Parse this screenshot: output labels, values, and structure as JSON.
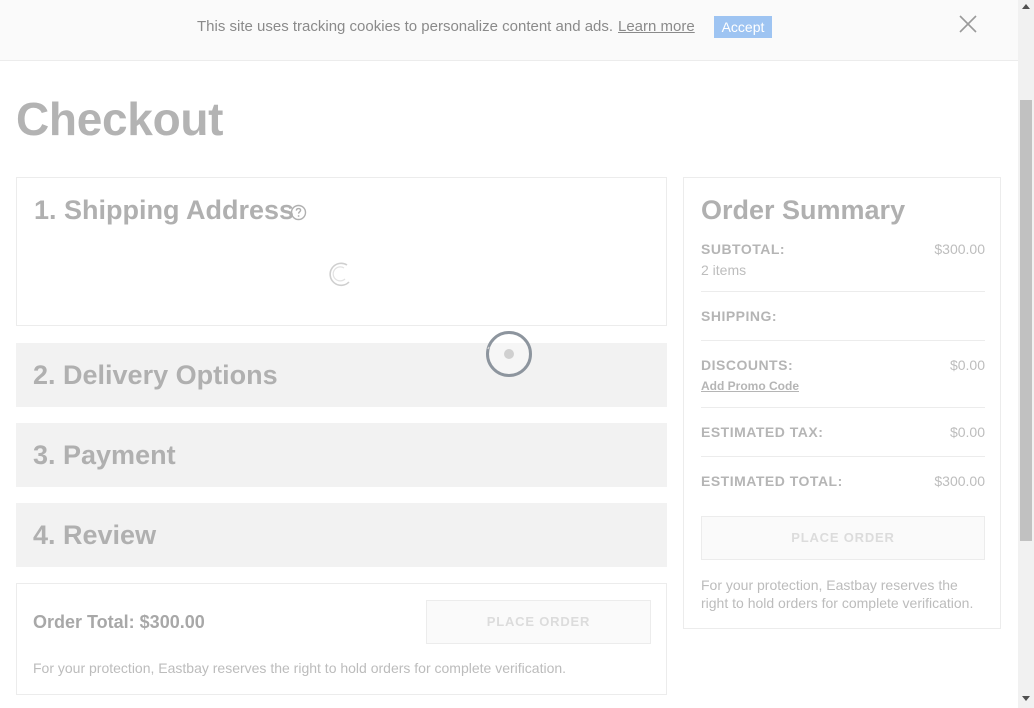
{
  "cookie_banner": {
    "text": "This site uses tracking cookies to personalize content and ads.",
    "learn_more": "Learn more",
    "accept": "Accept"
  },
  "page_title": "Checkout",
  "steps": [
    {
      "title": "1. Shipping Address"
    },
    {
      "title": "2. Delivery Options"
    },
    {
      "title": "3. Payment"
    },
    {
      "title": "4. Review"
    }
  ],
  "order_total_panel": {
    "label": "Order Total: $300.00",
    "place_order": "PLACE ORDER",
    "protection": "For your protection, Eastbay reserves the right to hold orders for complete verification."
  },
  "order_summary": {
    "title": "Order Summary",
    "subtotal_label": "SUBTOTAL:",
    "subtotal_value": "$300.00",
    "items_count": "2 items",
    "shipping_label": "SHIPPING:",
    "discounts_label": "DISCOUNTS:",
    "discounts_value": "$0.00",
    "promo_link": "Add Promo Code",
    "tax_label": "ESTIMATED TAX:",
    "tax_value": "$0.00",
    "total_label": "ESTIMATED TOTAL:",
    "total_value": "$300.00",
    "place_order": "PLACE ORDER",
    "protection": "For your protection, Eastbay reserves the right to hold orders for complete verification."
  },
  "icons": {
    "close": "close-icon",
    "help": "help-icon",
    "spinner": "loading-spinner-icon"
  }
}
